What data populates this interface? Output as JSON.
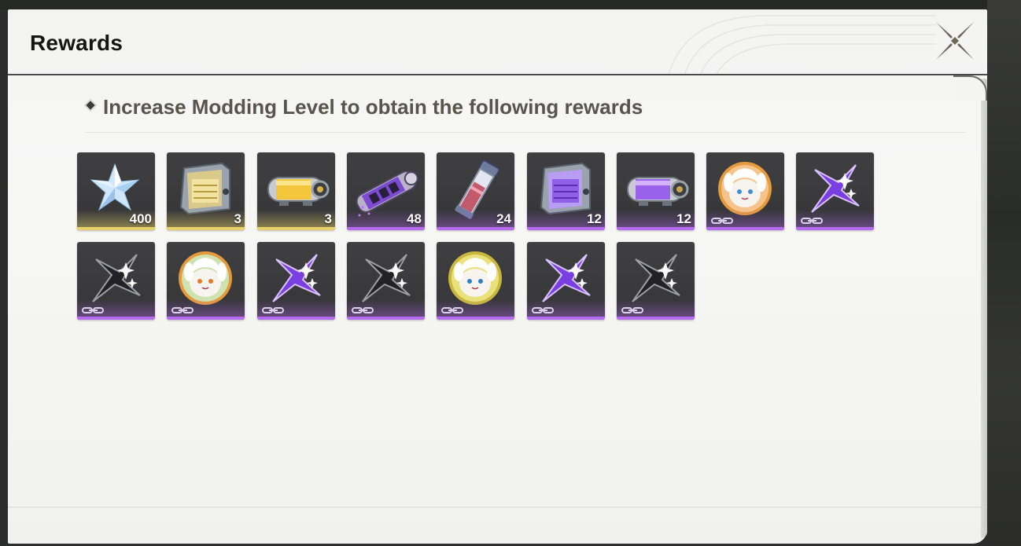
{
  "dialog": {
    "title": "Rewards",
    "subtitle": "Increase Modding Level to obtain the following rewards"
  },
  "colors": {
    "gold": "#e7d26a",
    "purple": "#b56cf0",
    "panel": "#f3f3f2",
    "tile": "#3c3c3e"
  },
  "rewards": [
    {
      "icon": "crystal-star-icon",
      "rarity": "gold",
      "count": "400"
    },
    {
      "icon": "gold-crate-icon",
      "rarity": "gold",
      "count": "3"
    },
    {
      "icon": "gold-capsule-icon",
      "rarity": "gold",
      "count": "3"
    },
    {
      "icon": "purple-cylinder-icon",
      "rarity": "purple",
      "count": "48"
    },
    {
      "icon": "purple-vial-icon",
      "rarity": "purple",
      "count": "24"
    },
    {
      "icon": "purple-crate-icon",
      "rarity": "purple",
      "count": "12"
    },
    {
      "icon": "purple-capsule-icon",
      "rarity": "purple",
      "count": "12"
    },
    {
      "icon": "avatar-orange-icon",
      "rarity": "purple",
      "count": ""
    },
    {
      "icon": "purple-shuriken-icon",
      "rarity": "purple",
      "count": ""
    },
    {
      "icon": "dark-shuriken-icon",
      "rarity": "purple",
      "count": ""
    },
    {
      "icon": "avatar-green-icon",
      "rarity": "purple",
      "count": ""
    },
    {
      "icon": "purple-shuriken-icon",
      "rarity": "purple",
      "count": ""
    },
    {
      "icon": "dark-shuriken-icon",
      "rarity": "purple",
      "count": ""
    },
    {
      "icon": "avatar-yellow-icon",
      "rarity": "purple",
      "count": ""
    },
    {
      "icon": "purple-shuriken-icon",
      "rarity": "purple",
      "count": ""
    },
    {
      "icon": "dark-shuriken-icon",
      "rarity": "purple",
      "count": ""
    }
  ]
}
